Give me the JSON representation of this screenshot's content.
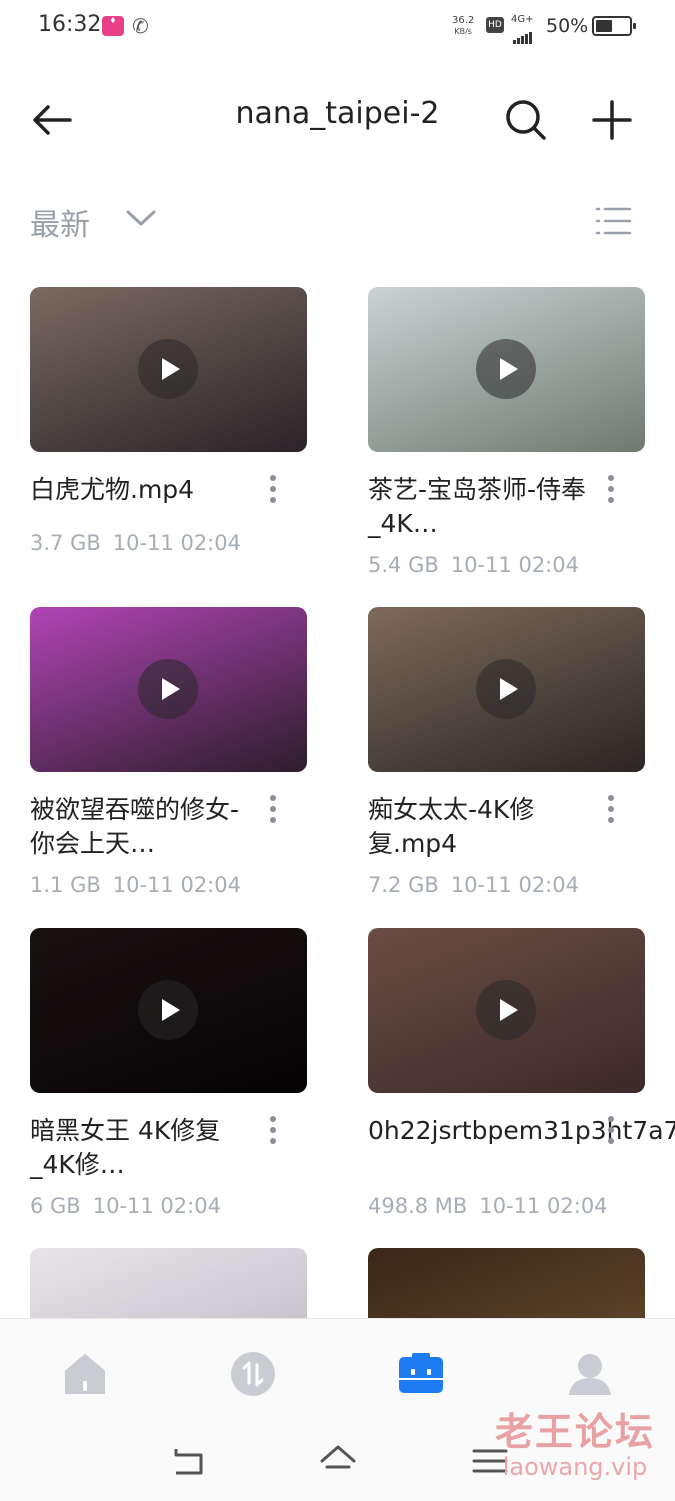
{
  "status_bar": {
    "time": "16:32",
    "speed_value": "36.2",
    "speed_unit": "KB/s",
    "hd_label": "HD",
    "network": "4G+",
    "battery": "50%",
    "battery_level": 0.5
  },
  "header": {
    "title": "nana_taipei-2",
    "back_icon": "arrow-left-icon",
    "search_icon": "search-icon",
    "add_icon": "plus-icon"
  },
  "sort": {
    "label": "最新",
    "view_icon": "list-view-icon"
  },
  "files": [
    {
      "name": "白虎尤物.mp4",
      "size": "3.7 GB",
      "date": "10-11 02:04",
      "colors": [
        "#7a6a60",
        "#2a2328"
      ]
    },
    {
      "name": "茶艺-宝岛茶师-侍奉_4K…",
      "size": "5.4 GB",
      "date": "10-11 02:04",
      "colors": [
        "#c9d3d4",
        "#6e7a70"
      ]
    },
    {
      "name": "被欲望吞噬的修女-你会上天…",
      "size": "1.1 GB",
      "date": "10-11 02:04",
      "colors": [
        "#b045b5",
        "#2c1d2a"
      ]
    },
    {
      "name": "痴女太太-4K修复.mp4",
      "size": "7.2 GB",
      "date": "10-11 02:04",
      "colors": [
        "#7d6a5b",
        "#2a2624"
      ]
    },
    {
      "name": "暗黑女王 4K修复 _4K修…",
      "size": "6 GB",
      "date": "10-11 02:04",
      "colors": [
        "#1a1112",
        "#050304"
      ]
    },
    {
      "name": "0h22jsrtbpem31p3ht7a7…",
      "size": "498.8 MB",
      "date": "10-11 02:04",
      "colors": [
        "#6b4c44",
        "#3b2a28"
      ]
    },
    {
      "name": "",
      "size": "",
      "date": "",
      "colors": [
        "#e9e3ea",
        "#b8b3bb"
      ]
    },
    {
      "name": "",
      "size": "",
      "date": "",
      "colors": [
        "#3a2718",
        "#6d5030"
      ]
    }
  ],
  "bottom_nav": [
    {
      "name": "home-icon",
      "active": false
    },
    {
      "name": "transfer-icon",
      "active": false
    },
    {
      "name": "files-icon",
      "active": true
    },
    {
      "name": "profile-icon",
      "active": false
    }
  ],
  "system_nav": [
    "back-icon",
    "home-outline-icon",
    "menu-icon"
  ],
  "watermark": {
    "line1": "老王论坛",
    "line2": "laowang.vip"
  },
  "colors": {
    "accent": "#1f7bf2",
    "inactive": "#c9ccd2"
  }
}
